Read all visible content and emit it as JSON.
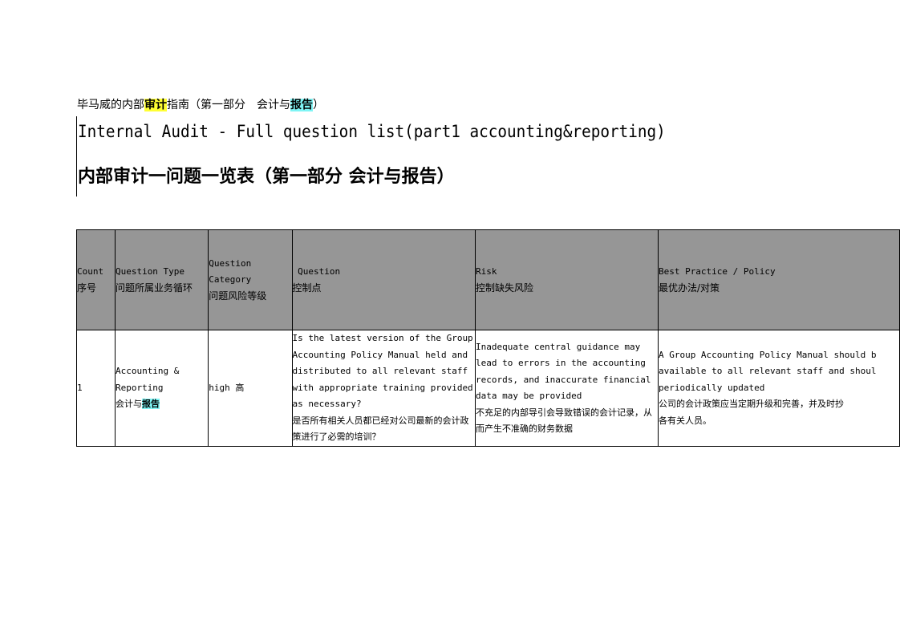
{
  "document": {
    "subtitle": {
      "prefix": "毕马威的内部",
      "hl1": "审计",
      "middle": "指南（第一部分　会计与",
      "hl2": "报告",
      "suffix": "）"
    },
    "title_en": "Internal Audit - Full question list(part1 accounting&reporting)",
    "title_zh": "内部审计一问题一览表（第一部分 会计与报告）"
  },
  "table": {
    "headers": [
      {
        "en": "Count",
        "zh": "序号"
      },
      {
        "en": "Question Type",
        "zh": "问题所属业务循环"
      },
      {
        "en1": "Question",
        "en2": "Category",
        "zh": "问题风险等级"
      },
      {
        "en": " Question",
        "zh": "控制点"
      },
      {
        "en": "Risk",
        "zh": "控制缺失风险"
      },
      {
        "en": "Best Practice / Policy",
        "zh": "最优办法/对策"
      }
    ],
    "rows": [
      {
        "count": "1",
        "type_en": "Accounting & Reporting",
        "type_zh_prefix": "会计与",
        "type_zh_hl": "报告",
        "category": "high 高",
        "question_en": "Is the latest version of the Group Accounting Policy Manual held and distributed to all relevant staff with appropriate training provided as necessary?",
        "question_zh": "是否所有相关人员都已经对公司最新的会计政策进行了必需的培训？",
        "risk_en": "Inadequate central guidance may lead to errors in the accounting records, and inaccurate financial data may be provided",
        "risk_zh": "不充足的内部导引会导致错误的会计记录，从而产生不准确的财务数据",
        "best_en_1": "A Group Accounting Policy Manual should b",
        "best_en_2": "available to all relevant staff and shoul",
        "best_en_3": "periodically updated",
        "best_zh_1": "公司的会计政策应当定期升级和完善，并及时抄",
        "best_zh_2": "各有关人员。"
      }
    ]
  }
}
